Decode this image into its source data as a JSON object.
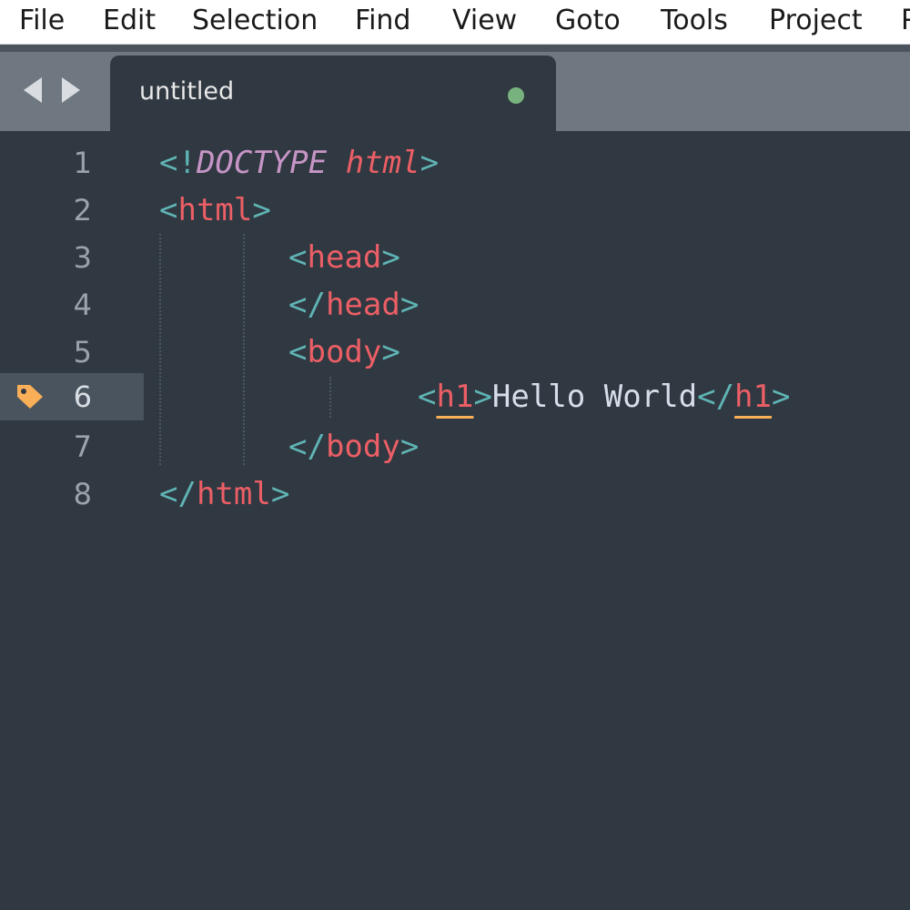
{
  "menu": {
    "items": [
      "File",
      "Edit",
      "Selection",
      "Find",
      "View",
      "Goto",
      "Tools",
      "Project",
      "P"
    ]
  },
  "tabs": [
    {
      "title": "untitled",
      "modified": true
    }
  ],
  "icons": {
    "back": "triangle-left-icon",
    "forward": "triangle-right-icon",
    "bookmark": "tag-icon",
    "modified": "dot-icon"
  },
  "editor": {
    "active_line": 6,
    "line_numbers": [
      "1",
      "2",
      "3",
      "4",
      "5",
      "6",
      "7",
      "8"
    ],
    "lines": [
      {
        "t1": "<!",
        "t2": "DOCTYPE",
        "t3": " ",
        "t4": "html",
        "t5": ">"
      },
      {
        "t1": "<",
        "t2": "html",
        "t3": ">"
      },
      {
        "t1": "<",
        "t2": "head",
        "t3": ">"
      },
      {
        "t1": "</",
        "t2": "head",
        "t3": ">"
      },
      {
        "t1": "<",
        "t2": "body",
        "t3": ">"
      },
      {
        "t1": "<",
        "t2": "h1",
        "t3": ">",
        "t4": "Hello World",
        "t5": "</",
        "t6": "h1",
        "t7": ">"
      },
      {
        "t1": "</",
        "t2": "body",
        "t3": ">"
      },
      {
        "t1": "</",
        "t2": "html",
        "t3": ">"
      }
    ]
  },
  "colors": {
    "background": "#303841",
    "tag": "#ec5f66",
    "punctuation": "#5fb4b4",
    "keyword": "#c695c6",
    "text": "#d8dee9",
    "bookmark": "#f9ae58",
    "modified_dot": "#78b27f"
  }
}
